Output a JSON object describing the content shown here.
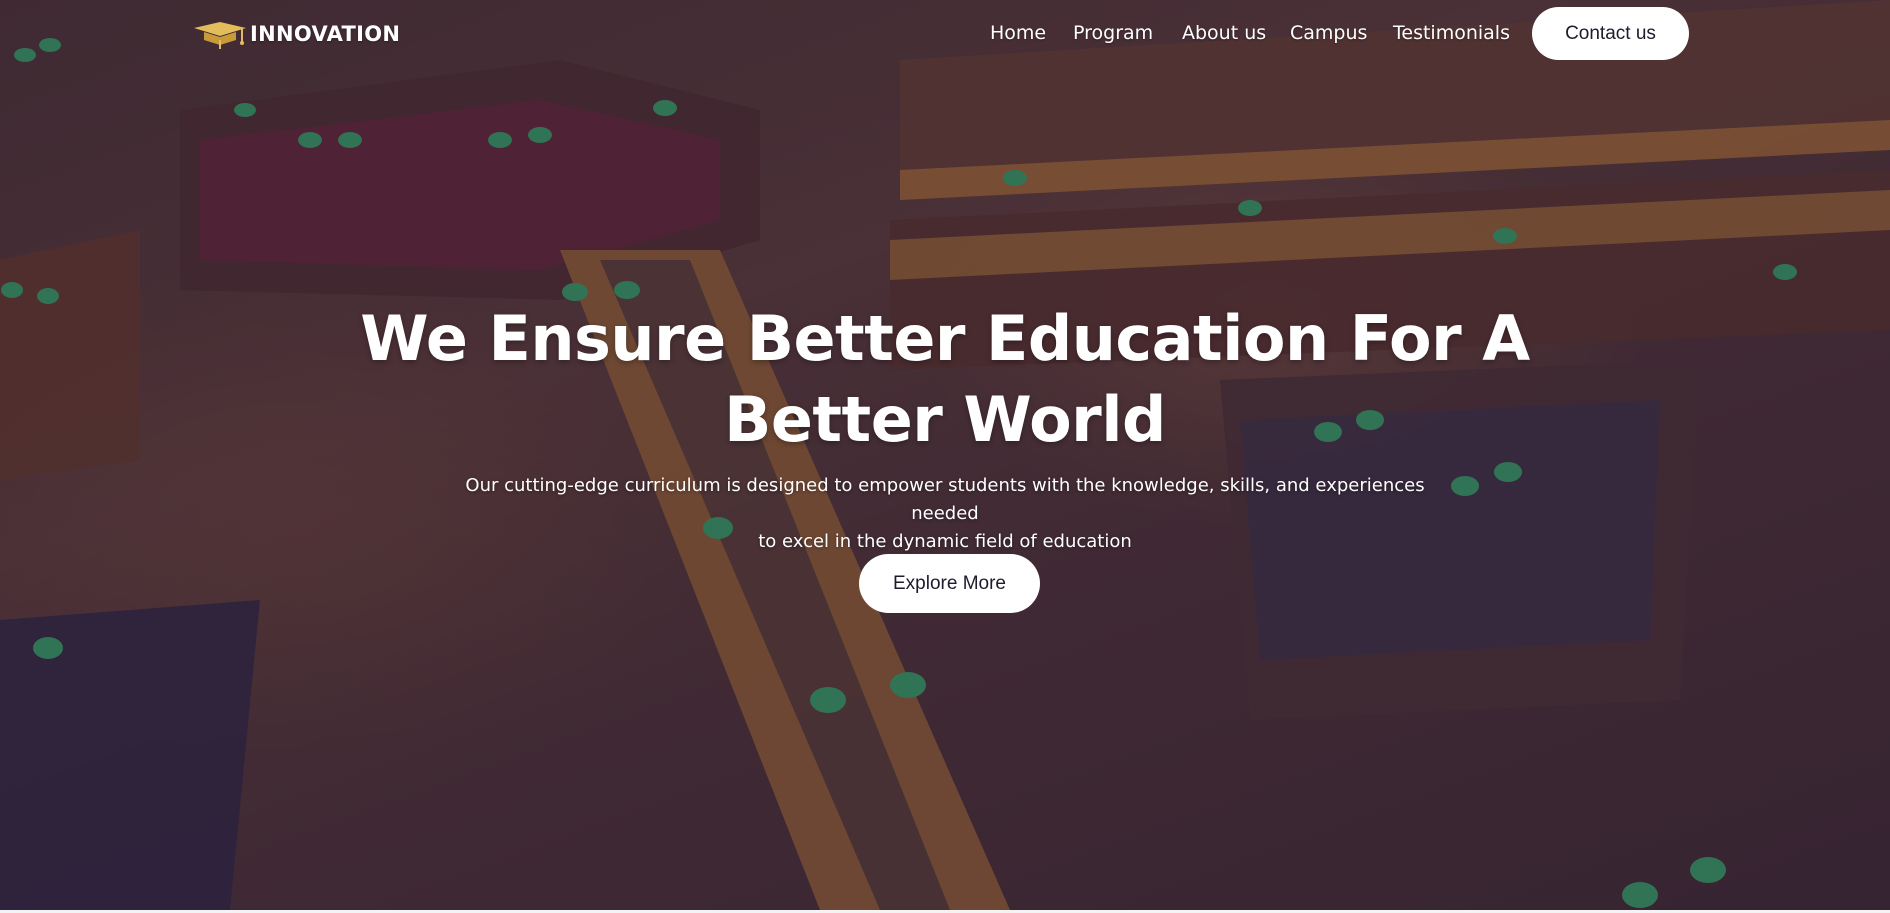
{
  "brand": {
    "name": "INNOVATION",
    "logo_icon": "graduation-cap-icon",
    "accent": "#d4a84a"
  },
  "nav": {
    "items": [
      {
        "label": "Home"
      },
      {
        "label": "Program"
      },
      {
        "label": "About us"
      },
      {
        "label": "Campus"
      },
      {
        "label": "Testimonials"
      }
    ],
    "contact_label": "Contact us"
  },
  "hero": {
    "headline_line1": "We Ensure Better Education For A",
    "headline_line2": "Better World",
    "subtext_line1": "Our cutting-edge curriculum is designed to empower students with the knowledge, skills, and experiences needed",
    "subtext_line2": "to excel in the dynamic field of education",
    "cta_label": "Explore More",
    "background_image": "library-reading-room-photo"
  },
  "colors": {
    "overlay": "#1e163c",
    "button_bg": "#ffffff",
    "button_text": "#1e1b2e",
    "text": "#ffffff"
  }
}
